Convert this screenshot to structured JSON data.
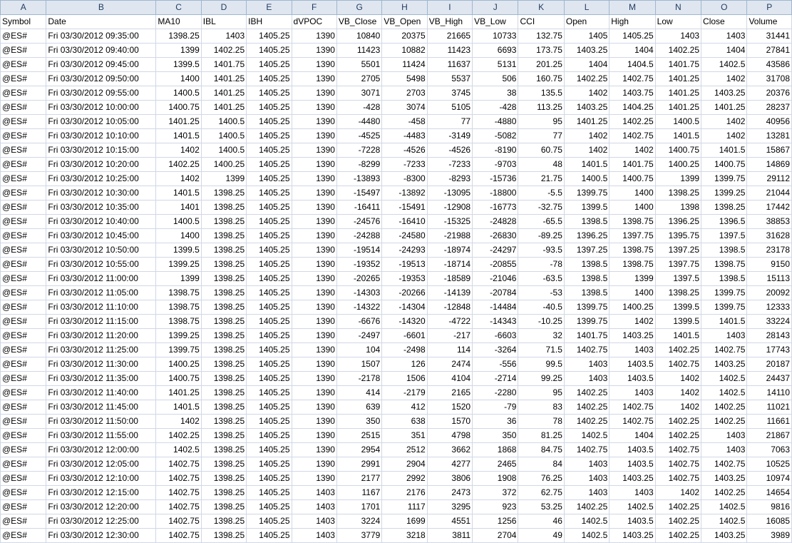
{
  "columns": [
    "A",
    "B",
    "C",
    "D",
    "E",
    "F",
    "G",
    "H",
    "I",
    "J",
    "K",
    "L",
    "M",
    "N",
    "O",
    "P"
  ],
  "rows": [
    [
      "Symbol",
      "Date",
      "MA10",
      "IBL",
      "IBH",
      "dVPOC",
      "VB_Close",
      "VB_Open",
      "VB_High",
      "VB_Low",
      "CCI",
      "Open",
      "High",
      "Low",
      "Close",
      "Volume"
    ],
    [
      "@ES#",
      "Fri 03/30/2012 09:35:00",
      "1398.25",
      "1403",
      "1405.25",
      "1390",
      "10840",
      "20375",
      "21665",
      "10733",
      "132.75",
      "1405",
      "1405.25",
      "1403",
      "1403",
      "31441"
    ],
    [
      "@ES#",
      "Fri 03/30/2012 09:40:00",
      "1399",
      "1402.25",
      "1405.25",
      "1390",
      "11423",
      "10882",
      "11423",
      "6693",
      "173.75",
      "1403.25",
      "1404",
      "1402.25",
      "1404",
      "27841"
    ],
    [
      "@ES#",
      "Fri 03/30/2012 09:45:00",
      "1399.5",
      "1401.75",
      "1405.25",
      "1390",
      "5501",
      "11424",
      "11637",
      "5131",
      "201.25",
      "1404",
      "1404.5",
      "1401.75",
      "1402.5",
      "43586"
    ],
    [
      "@ES#",
      "Fri 03/30/2012 09:50:00",
      "1400",
      "1401.25",
      "1405.25",
      "1390",
      "2705",
      "5498",
      "5537",
      "506",
      "160.75",
      "1402.25",
      "1402.75",
      "1401.25",
      "1402",
      "31708"
    ],
    [
      "@ES#",
      "Fri 03/30/2012 09:55:00",
      "1400.5",
      "1401.25",
      "1405.25",
      "1390",
      "3071",
      "2703",
      "3745",
      "38",
      "135.5",
      "1402",
      "1403.75",
      "1401.25",
      "1403.25",
      "20376"
    ],
    [
      "@ES#",
      "Fri 03/30/2012 10:00:00",
      "1400.75",
      "1401.25",
      "1405.25",
      "1390",
      "-428",
      "3074",
      "5105",
      "-428",
      "113.25",
      "1403.25",
      "1404.25",
      "1401.25",
      "1401.25",
      "28237"
    ],
    [
      "@ES#",
      "Fri 03/30/2012 10:05:00",
      "1401.25",
      "1400.5",
      "1405.25",
      "1390",
      "-4480",
      "-458",
      "77",
      "-4880",
      "95",
      "1401.25",
      "1402.25",
      "1400.5",
      "1402",
      "40956"
    ],
    [
      "@ES#",
      "Fri 03/30/2012 10:10:00",
      "1401.5",
      "1400.5",
      "1405.25",
      "1390",
      "-4525",
      "-4483",
      "-3149",
      "-5082",
      "77",
      "1402",
      "1402.75",
      "1401.5",
      "1402",
      "13281"
    ],
    [
      "@ES#",
      "Fri 03/30/2012 10:15:00",
      "1402",
      "1400.5",
      "1405.25",
      "1390",
      "-7228",
      "-4526",
      "-4526",
      "-8190",
      "60.75",
      "1402",
      "1402",
      "1400.75",
      "1401.5",
      "15867"
    ],
    [
      "@ES#",
      "Fri 03/30/2012 10:20:00",
      "1402.25",
      "1400.25",
      "1405.25",
      "1390",
      "-8299",
      "-7233",
      "-7233",
      "-9703",
      "48",
      "1401.5",
      "1401.75",
      "1400.25",
      "1400.75",
      "14869"
    ],
    [
      "@ES#",
      "Fri 03/30/2012 10:25:00",
      "1402",
      "1399",
      "1405.25",
      "1390",
      "-13893",
      "-8300",
      "-8293",
      "-15736",
      "21.75",
      "1400.5",
      "1400.75",
      "1399",
      "1399.75",
      "29112"
    ],
    [
      "@ES#",
      "Fri 03/30/2012 10:30:00",
      "1401.5",
      "1398.25",
      "1405.25",
      "1390",
      "-15497",
      "-13892",
      "-13095",
      "-18800",
      "-5.5",
      "1399.75",
      "1400",
      "1398.25",
      "1399.25",
      "21044"
    ],
    [
      "@ES#",
      "Fri 03/30/2012 10:35:00",
      "1401",
      "1398.25",
      "1405.25",
      "1390",
      "-16411",
      "-15491",
      "-12908",
      "-16773",
      "-32.75",
      "1399.5",
      "1400",
      "1398",
      "1398.25",
      "17442"
    ],
    [
      "@ES#",
      "Fri 03/30/2012 10:40:00",
      "1400.5",
      "1398.25",
      "1405.25",
      "1390",
      "-24576",
      "-16410",
      "-15325",
      "-24828",
      "-65.5",
      "1398.5",
      "1398.75",
      "1396.25",
      "1396.5",
      "38853"
    ],
    [
      "@ES#",
      "Fri 03/30/2012 10:45:00",
      "1400",
      "1398.25",
      "1405.25",
      "1390",
      "-24288",
      "-24580",
      "-21988",
      "-26830",
      "-89.25",
      "1396.25",
      "1397.75",
      "1395.75",
      "1397.5",
      "31628"
    ],
    [
      "@ES#",
      "Fri 03/30/2012 10:50:00",
      "1399.5",
      "1398.25",
      "1405.25",
      "1390",
      "-19514",
      "-24293",
      "-18974",
      "-24297",
      "-93.5",
      "1397.25",
      "1398.75",
      "1397.25",
      "1398.5",
      "23178"
    ],
    [
      "@ES#",
      "Fri 03/30/2012 10:55:00",
      "1399.25",
      "1398.25",
      "1405.25",
      "1390",
      "-19352",
      "-19513",
      "-18714",
      "-20855",
      "-78",
      "1398.5",
      "1398.75",
      "1397.75",
      "1398.75",
      "9150"
    ],
    [
      "@ES#",
      "Fri 03/30/2012 11:00:00",
      "1399",
      "1398.25",
      "1405.25",
      "1390",
      "-20265",
      "-19353",
      "-18589",
      "-21046",
      "-63.5",
      "1398.5",
      "1399",
      "1397.5",
      "1398.5",
      "15113"
    ],
    [
      "@ES#",
      "Fri 03/30/2012 11:05:00",
      "1398.75",
      "1398.25",
      "1405.25",
      "1390",
      "-14303",
      "-20266",
      "-14139",
      "-20784",
      "-53",
      "1398.5",
      "1400",
      "1398.25",
      "1399.75",
      "20092"
    ],
    [
      "@ES#",
      "Fri 03/30/2012 11:10:00",
      "1398.75",
      "1398.25",
      "1405.25",
      "1390",
      "-14322",
      "-14304",
      "-12848",
      "-14484",
      "-40.5",
      "1399.75",
      "1400.25",
      "1399.5",
      "1399.75",
      "12333"
    ],
    [
      "@ES#",
      "Fri 03/30/2012 11:15:00",
      "1398.75",
      "1398.25",
      "1405.25",
      "1390",
      "-6676",
      "-14320",
      "-4722",
      "-14343",
      "-10.25",
      "1399.75",
      "1402",
      "1399.5",
      "1401.5",
      "33224"
    ],
    [
      "@ES#",
      "Fri 03/30/2012 11:20:00",
      "1399.25",
      "1398.25",
      "1405.25",
      "1390",
      "-2497",
      "-6601",
      "-217",
      "-6603",
      "32",
      "1401.75",
      "1403.25",
      "1401.5",
      "1403",
      "28143"
    ],
    [
      "@ES#",
      "Fri 03/30/2012 11:25:00",
      "1399.75",
      "1398.25",
      "1405.25",
      "1390",
      "104",
      "-2498",
      "114",
      "-3264",
      "71.5",
      "1402.75",
      "1403",
      "1402.25",
      "1402.75",
      "17743"
    ],
    [
      "@ES#",
      "Fri 03/30/2012 11:30:00",
      "1400.25",
      "1398.25",
      "1405.25",
      "1390",
      "1507",
      "126",
      "2474",
      "-556",
      "99.5",
      "1403",
      "1403.5",
      "1402.75",
      "1403.25",
      "20187"
    ],
    [
      "@ES#",
      "Fri 03/30/2012 11:35:00",
      "1400.75",
      "1398.25",
      "1405.25",
      "1390",
      "-2178",
      "1506",
      "4104",
      "-2714",
      "99.25",
      "1403",
      "1403.5",
      "1402",
      "1402.5",
      "24437"
    ],
    [
      "@ES#",
      "Fri 03/30/2012 11:40:00",
      "1401.25",
      "1398.25",
      "1405.25",
      "1390",
      "414",
      "-2179",
      "2165",
      "-2280",
      "95",
      "1402.25",
      "1403",
      "1402",
      "1402.5",
      "14110"
    ],
    [
      "@ES#",
      "Fri 03/30/2012 11:45:00",
      "1401.5",
      "1398.25",
      "1405.25",
      "1390",
      "639",
      "412",
      "1520",
      "-79",
      "83",
      "1402.25",
      "1402.75",
      "1402",
      "1402.25",
      "11021"
    ],
    [
      "@ES#",
      "Fri 03/30/2012 11:50:00",
      "1402",
      "1398.25",
      "1405.25",
      "1390",
      "350",
      "638",
      "1570",
      "36",
      "78",
      "1402.25",
      "1402.75",
      "1402.25",
      "1402.25",
      "11661"
    ],
    [
      "@ES#",
      "Fri 03/30/2012 11:55:00",
      "1402.25",
      "1398.25",
      "1405.25",
      "1390",
      "2515",
      "351",
      "4798",
      "350",
      "81.25",
      "1402.5",
      "1404",
      "1402.25",
      "1403",
      "21867"
    ],
    [
      "@ES#",
      "Fri 03/30/2012 12:00:00",
      "1402.5",
      "1398.25",
      "1405.25",
      "1390",
      "2954",
      "2512",
      "3662",
      "1868",
      "84.75",
      "1402.75",
      "1403.5",
      "1402.75",
      "1403",
      "7063"
    ],
    [
      "@ES#",
      "Fri 03/30/2012 12:05:00",
      "1402.75",
      "1398.25",
      "1405.25",
      "1390",
      "2991",
      "2904",
      "4277",
      "2465",
      "84",
      "1403",
      "1403.5",
      "1402.75",
      "1402.75",
      "10525"
    ],
    [
      "@ES#",
      "Fri 03/30/2012 12:10:00",
      "1402.75",
      "1398.25",
      "1405.25",
      "1390",
      "2177",
      "2992",
      "3806",
      "1908",
      "76.25",
      "1403",
      "1403.25",
      "1402.75",
      "1403.25",
      "10974"
    ],
    [
      "@ES#",
      "Fri 03/30/2012 12:15:00",
      "1402.75",
      "1398.25",
      "1405.25",
      "1403",
      "1167",
      "2176",
      "2473",
      "372",
      "62.75",
      "1403",
      "1403",
      "1402",
      "1402.25",
      "14654"
    ],
    [
      "@ES#",
      "Fri 03/30/2012 12:20:00",
      "1402.75",
      "1398.25",
      "1405.25",
      "1403",
      "1701",
      "1117",
      "3295",
      "923",
      "53.25",
      "1402.25",
      "1402.5",
      "1402.25",
      "1402.5",
      "9816"
    ],
    [
      "@ES#",
      "Fri 03/30/2012 12:25:00",
      "1402.75",
      "1398.25",
      "1405.25",
      "1403",
      "3224",
      "1699",
      "4551",
      "1256",
      "46",
      "1402.5",
      "1403.5",
      "1402.25",
      "1402.5",
      "16085"
    ],
    [
      "@ES#",
      "Fri 03/30/2012 12:30:00",
      "1402.75",
      "1398.25",
      "1405.25",
      "1403",
      "3779",
      "3218",
      "3811",
      "2704",
      "49",
      "1402.5",
      "1403.25",
      "1402.25",
      "1403.25",
      "3989"
    ]
  ]
}
